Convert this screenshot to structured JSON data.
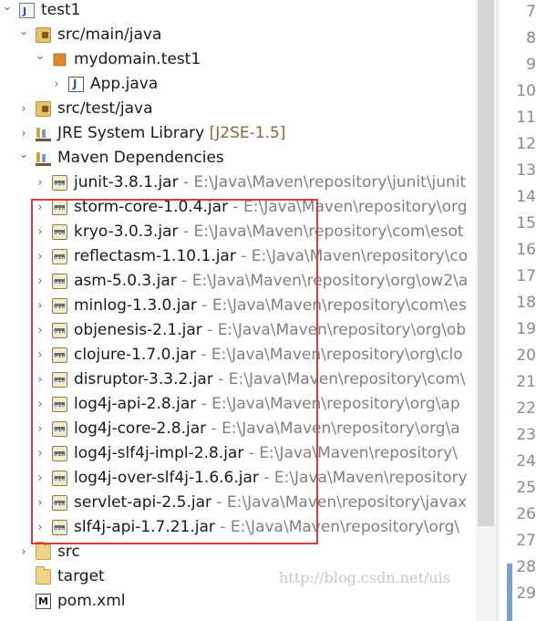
{
  "tree": {
    "rows": [
      {
        "chevron": "open",
        "icon": "project-icon",
        "label": "test1",
        "path": ""
      },
      {
        "chevron": "open",
        "icon": "source-folder-icon",
        "label": "src/main/java",
        "path": ""
      },
      {
        "chevron": "open",
        "icon": "package-icon",
        "label": "mydomain.test1",
        "path": ""
      },
      {
        "chevron": "closed",
        "icon": "java-file-icon",
        "label": "App.java",
        "path": ""
      },
      {
        "chevron": "closed",
        "icon": "source-folder-icon",
        "label": "src/test/java",
        "path": ""
      },
      {
        "chevron": "closed",
        "icon": "library-icon",
        "label": "JRE System Library",
        "path": "",
        "suffix": "[J2SE-1.5]"
      },
      {
        "chevron": "open",
        "icon": "library-icon",
        "label": "Maven Dependencies",
        "path": ""
      },
      {
        "chevron": "closed",
        "icon": "jar-icon",
        "label": "junit-3.8.1.jar",
        "path": " - E:\\Java\\Maven\\repository\\junit\\junit"
      },
      {
        "chevron": "closed",
        "icon": "jar-icon",
        "label": "storm-core-1.0.4.jar",
        "path": " - E:\\Java\\Maven\\repository\\org"
      },
      {
        "chevron": "closed",
        "icon": "jar-icon",
        "label": "kryo-3.0.3.jar",
        "path": " - E:\\Java\\Maven\\repository\\com\\esot"
      },
      {
        "chevron": "closed",
        "icon": "jar-icon",
        "label": "reflectasm-1.10.1.jar",
        "path": " - E:\\Java\\Maven\\repository\\co"
      },
      {
        "chevron": "closed",
        "icon": "jar-icon",
        "label": "asm-5.0.3.jar",
        "path": " - E:\\Java\\Maven\\repository\\org\\ow2\\a"
      },
      {
        "chevron": "closed",
        "icon": "jar-icon",
        "label": "minlog-1.3.0.jar",
        "path": " - E:\\Java\\Maven\\repository\\com\\es"
      },
      {
        "chevron": "closed",
        "icon": "jar-icon",
        "label": "objenesis-2.1.jar",
        "path": " - E:\\Java\\Maven\\repository\\org\\ob"
      },
      {
        "chevron": "closed",
        "icon": "jar-icon",
        "label": "clojure-1.7.0.jar",
        "path": " - E:\\Java\\Maven\\repository\\org\\clo"
      },
      {
        "chevron": "closed",
        "icon": "jar-icon",
        "label": "disruptor-3.3.2.jar",
        "path": " - E:\\Java\\Maven\\repository\\com\\"
      },
      {
        "chevron": "closed",
        "icon": "jar-icon",
        "label": "log4j-api-2.8.jar",
        "path": " - E:\\Java\\Maven\\repository\\org\\ap"
      },
      {
        "chevron": "closed",
        "icon": "jar-icon",
        "label": "log4j-core-2.8.jar",
        "path": " - E:\\Java\\Maven\\repository\\org\\a"
      },
      {
        "chevron": "closed",
        "icon": "jar-icon",
        "label": "log4j-slf4j-impl-2.8.jar",
        "path": " - E:\\Java\\Maven\\repository\\"
      },
      {
        "chevron": "closed",
        "icon": "jar-icon",
        "label": "log4j-over-slf4j-1.6.6.jar",
        "path": " - E:\\Java\\Maven\\repository"
      },
      {
        "chevron": "closed",
        "icon": "jar-icon",
        "label": "servlet-api-2.5.jar",
        "path": " - E:\\Java\\Maven\\repository\\javax"
      },
      {
        "chevron": "closed",
        "icon": "jar-icon",
        "label": "slf4j-api-1.7.21.jar",
        "path": " - E:\\Java\\Maven\\repository\\org\\"
      },
      {
        "chevron": "closed",
        "icon": "folder-icon",
        "label": "src",
        "path": ""
      },
      {
        "chevron": "none",
        "icon": "folder-icon",
        "label": "target",
        "path": ""
      },
      {
        "chevron": "none",
        "icon": "pom-file-icon",
        "label": "pom.xml",
        "path": ""
      }
    ]
  },
  "editor": {
    "line_numbers": [
      "7",
      "8",
      "9",
      "10",
      "11",
      "12",
      "13",
      "14",
      "15",
      "16",
      "17",
      "18",
      "19",
      "20",
      "21",
      "22",
      "23",
      "24",
      "25",
      "26",
      "27",
      "28",
      "29"
    ]
  },
  "watermark": "http://blog.csdn.net/uis",
  "colors": {
    "highlight_border": "#d23c3c",
    "path_text": "#808080",
    "library_suffix": "#8a6a3a"
  }
}
